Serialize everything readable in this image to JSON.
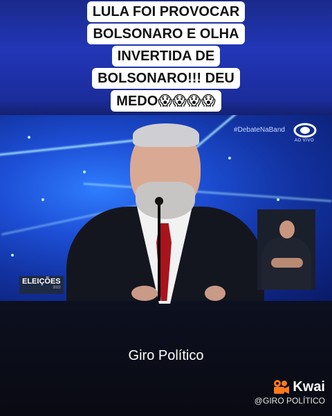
{
  "caption": {
    "lines": [
      "LULA FOI PROVOCAR",
      "BOLSONARO E OLHA",
      "INVERTIDA DE",
      "BOLSONARO!!! DEU"
    ],
    "last_line_text": "MEDO",
    "last_line_emojis": "😱😱😱😱"
  },
  "video": {
    "hashtag": "#DebateNaBand",
    "live_label": "AO VIVO",
    "badge_title": "ELEIÇÕES",
    "badge_year": "2022"
  },
  "overlay": {
    "subtitle": "Giro Político",
    "brand": "Kwai",
    "handle": "@GIRO POLÍTICO"
  },
  "colors": {
    "background_top": "#2236b8",
    "background_bottom": "#090a12",
    "tie": "#a8141c",
    "kwai_orange": "#ff7a1a"
  },
  "icons": [
    "band-logo-icon",
    "kwai-camera-icon"
  ]
}
